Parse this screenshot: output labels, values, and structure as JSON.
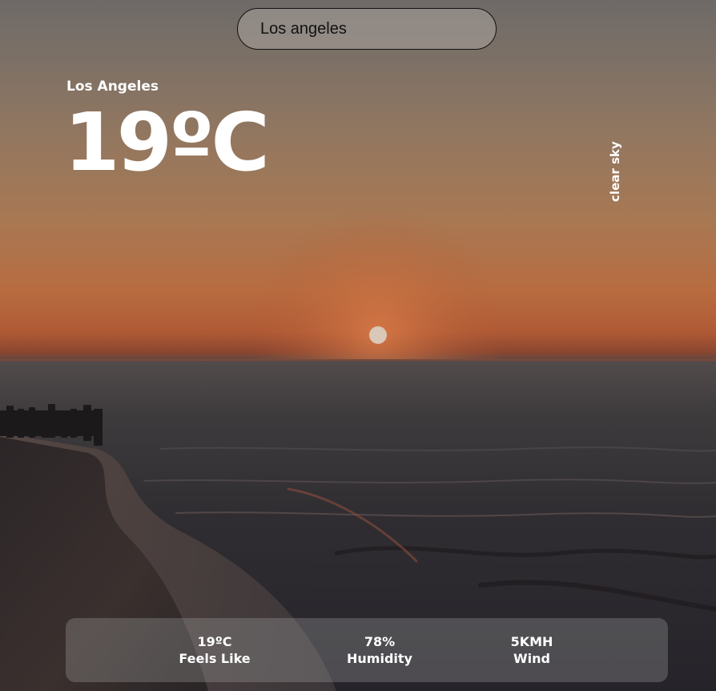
{
  "search": {
    "value": "Los angeles"
  },
  "location": {
    "city": "Los Angeles"
  },
  "current": {
    "temperature": "19ºC",
    "condition": "clear sky"
  },
  "stats": {
    "feels_like": {
      "value": "19ºC",
      "label": "Feels Like"
    },
    "humidity": {
      "value": "78%",
      "label": "Humidity"
    },
    "wind": {
      "value": "5KMH",
      "label": "Wind"
    }
  },
  "colors": {
    "text": "#ffffff",
    "search_text": "#111111",
    "panel": "rgba(170,170,170,0.30)"
  }
}
